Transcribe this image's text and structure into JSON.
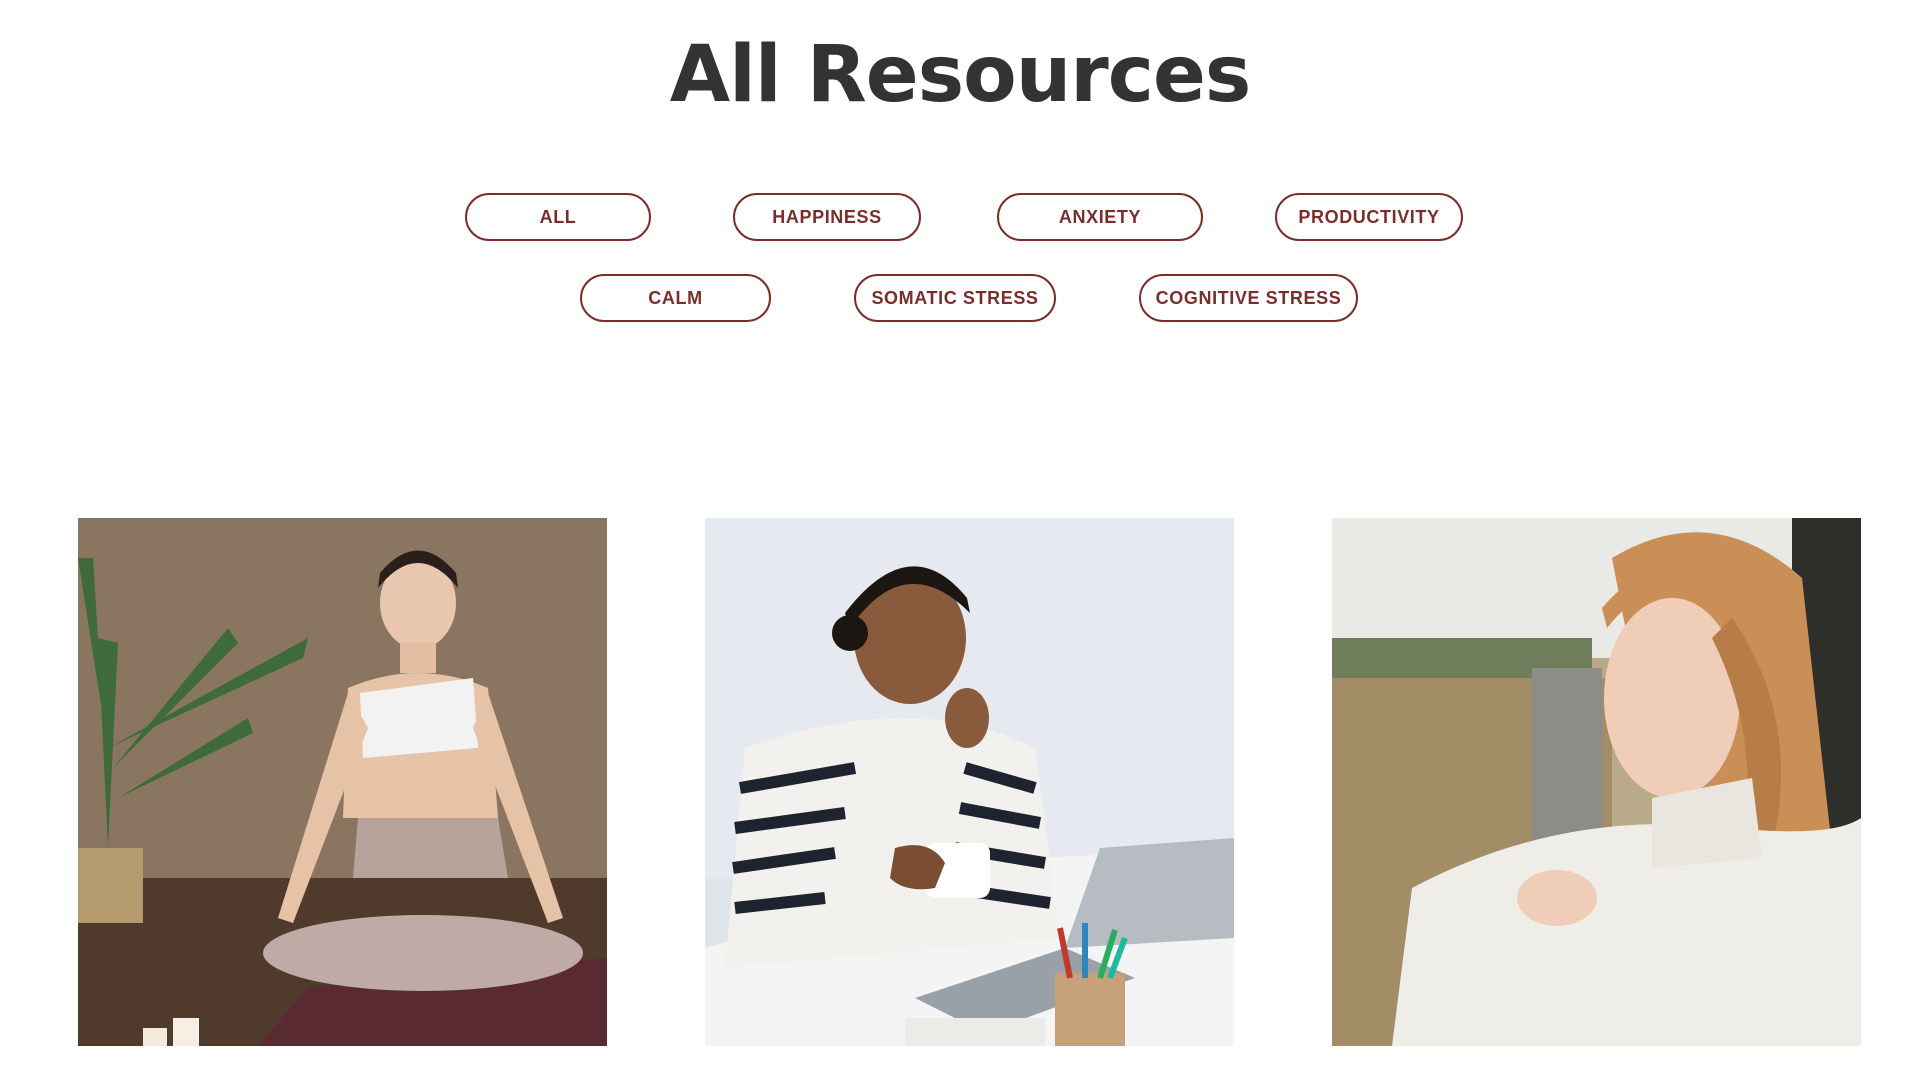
{
  "page": {
    "title": "All Resources"
  },
  "filters": [
    {
      "label": "ALL"
    },
    {
      "label": "HAPPINESS"
    },
    {
      "label": "ANXIETY"
    },
    {
      "label": "PRODUCTIVITY"
    },
    {
      "label": "CALM"
    },
    {
      "label": "SOMATIC STRESS"
    },
    {
      "label": "COGNITIVE STRESS"
    }
  ],
  "colors": {
    "accent": "#7a2e2c",
    "title": "#333333",
    "background": "#ffffff"
  },
  "cards": [
    {
      "image": "woman-meditating-yoga-photo"
    },
    {
      "image": "woman-smiling-laptop-coffee-photo"
    },
    {
      "image": "woman-red-hair-outdoors-photo"
    }
  ]
}
